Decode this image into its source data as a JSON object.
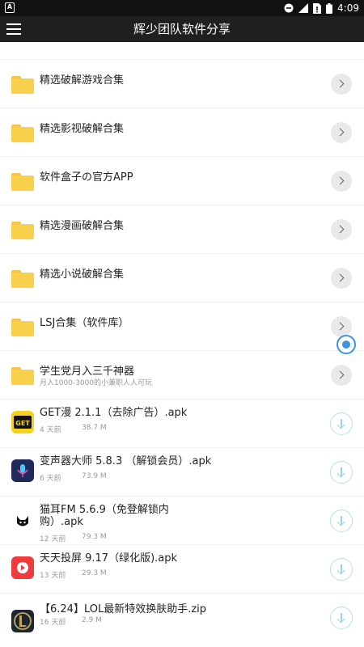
{
  "status_bar": {
    "left_badge": "A",
    "time": "4:09"
  },
  "app_bar": {
    "title": "辉少团队软件分享"
  },
  "folders": [
    {
      "title": "精选破解游戏合集",
      "subtitle": ""
    },
    {
      "title": "精选影视破解合集",
      "subtitle": ""
    },
    {
      "title": "软件盒子の官方APP",
      "subtitle": ""
    },
    {
      "title": "精选漫画破解合集",
      "subtitle": ""
    },
    {
      "title": "精选小说破解合集",
      "subtitle": ""
    },
    {
      "title": "LSJ合集（软件库）",
      "subtitle": ""
    },
    {
      "title": "学生党月入三千神器",
      "subtitle": "月入1000-3000的小兼职人人可玩"
    }
  ],
  "files": [
    {
      "title": "GET漫 2.1.1（去除广告）.apk",
      "date": "4 天前",
      "size": "38.7 M",
      "icon": "get-manga-icon",
      "color": "#f6d21c"
    },
    {
      "title": "变声器大师 5.8.3 （解锁会员）.apk",
      "date": "6 天前",
      "size": "73.9 M",
      "icon": "voice-changer-icon",
      "color": "#1f2a5a"
    },
    {
      "title": "猫耳FM 5.6.9（免登解锁内购）.apk",
      "date": "12 天前",
      "size": "79.3 M",
      "icon": "cat-ear-icon",
      "color": "#ffffff"
    },
    {
      "title": "天天投屏 9.17（绿化版).apk",
      "date": "13 天前",
      "size": "29.3 M",
      "icon": "screen-cast-icon",
      "color": "#ef3b3b"
    },
    {
      "title": "【6.24】LOL最新特效换肤助手.zip",
      "date": "16 天前",
      "size": "2.9 M",
      "icon": "lol-icon",
      "color": "#1b2733"
    }
  ]
}
